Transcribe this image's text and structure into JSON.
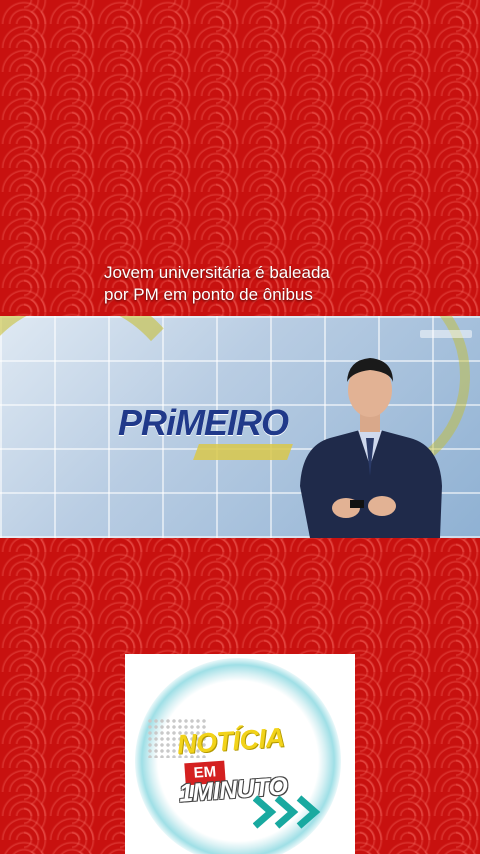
{
  "caption": {
    "line1": "Jovem universitária é baleada",
    "line2": "por PM em ponto de ônibus"
  },
  "video": {
    "program_logo": "PRiMEIRO"
  },
  "channel_logo": {
    "word1": "NOTÍCIA",
    "word2": "EM",
    "word3": "1MINUTO"
  },
  "colors": {
    "background": "#c8110f",
    "logo_yellow": "#f2d31a",
    "logo_red": "#d42020",
    "logo_teal": "#19a9a0",
    "primeiro_blue": "#20398a"
  },
  "icons": [
    "chevrons-right-icon"
  ]
}
